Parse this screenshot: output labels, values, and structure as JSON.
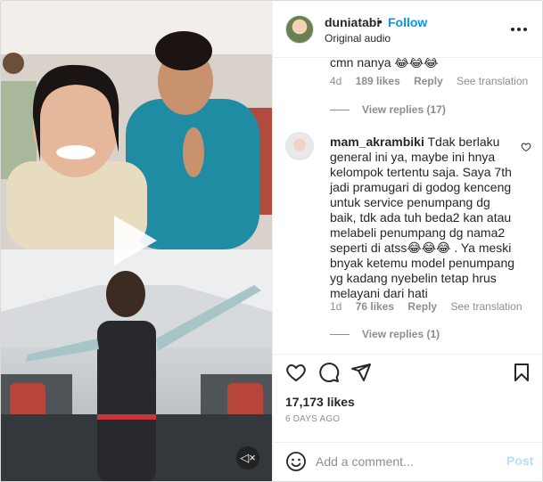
{
  "post": {
    "username": "duniatabi",
    "separator": "•",
    "follow_label": "Follow",
    "audio": "Original audio",
    "more_icon": "more-horizontal-icon"
  },
  "comments": [
    {
      "text": "cmn nanya 😂😂😂",
      "age": "4d",
      "likes": "189 likes",
      "reply_label": "Reply",
      "translation_label": "See translation",
      "view_replies": "View replies (17)"
    },
    {
      "username": "mam_akrambiki",
      "text": "Tdak berlaku general ini ya, maybe ini hnya kelompok tertentu saja. Saya 7th jadi pramugari di godog kenceng untuk service penumpang dg baik, tdk ada tuh beda2 kan atau melabeli penumpang dg nama2 seperti di atss😂😂😂 . Ya meski bnyak ketemu model penumpang yg kadang nyebelin tetap hrus melayani dari hati",
      "age": "1d",
      "likes": "76 likes",
      "reply_label": "Reply",
      "translation_label": "See translation",
      "view_replies": "View replies (1)"
    }
  ],
  "actions": {
    "likes": "17,173 likes",
    "date": "6 DAYS AGO"
  },
  "add_comment": {
    "placeholder": "Add a comment...",
    "post_label": "Post"
  },
  "colors": {
    "accent": "#0095f6",
    "muted": "#8e8e8e",
    "post_disabled": "#b2dffc"
  }
}
